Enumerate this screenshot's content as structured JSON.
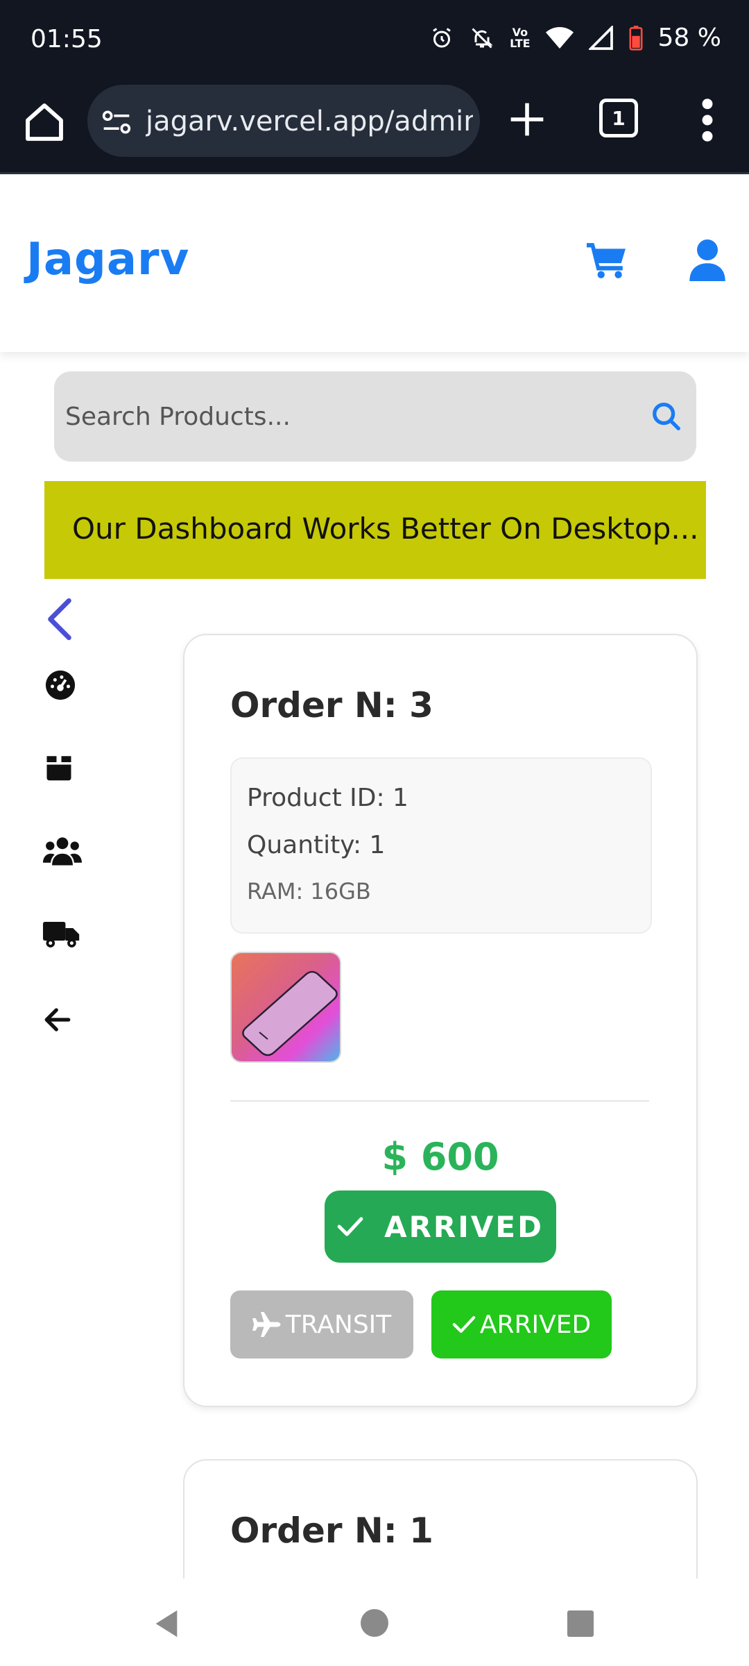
{
  "status_bar": {
    "time": "01:55",
    "battery": "58 %",
    "network_label": "Vo LTE"
  },
  "browser": {
    "url": "jagarv.vercel.app/admin/",
    "tab_count": "1"
  },
  "header": {
    "logo": "Jagarv"
  },
  "search": {
    "placeholder": "Search Products..."
  },
  "banner": {
    "text": "Our Dashboard Works Better On Desktop..."
  },
  "orders": [
    {
      "title": "Order N: 3",
      "product_id": "Product ID: 1",
      "quantity": "Quantity: 1",
      "ram": "RAM: 16GB",
      "price": "$ 600",
      "status": "ARRIVED",
      "transit_label": "TRANSIT",
      "arrived_label": "ARRIVED"
    },
    {
      "title": "Order N: 1"
    }
  ],
  "colors": {
    "brand": "#1a7cf2",
    "banner": "#c6c905",
    "price": "#2bb35a",
    "status_badge": "#25a954",
    "arrived_button": "#22c81a",
    "transit_button": "#b9b9b9"
  },
  "icons": {
    "sidebar": [
      "chevron-left-icon",
      "dashboard-icon",
      "box-icon",
      "users-icon",
      "truck-icon",
      "arrow-left-icon"
    ]
  }
}
